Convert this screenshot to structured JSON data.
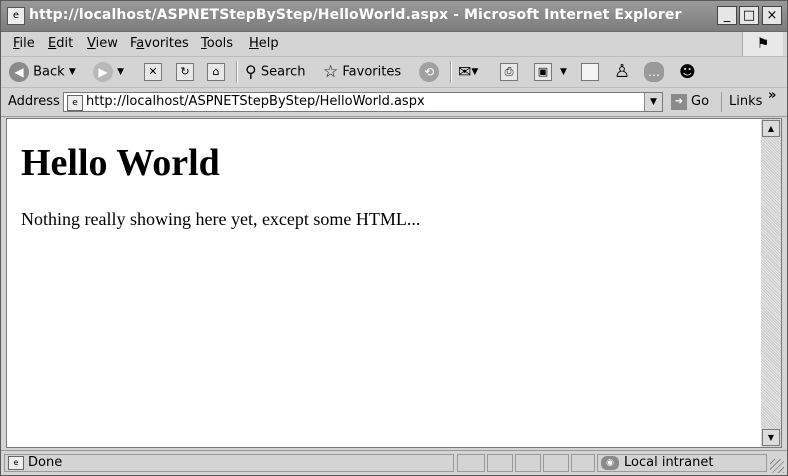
{
  "window": {
    "title": "http://localhost/ASPNETStepByStep/HelloWorld.aspx - Microsoft Internet Explorer",
    "minimize": "_",
    "maximize": "□",
    "close": "×"
  },
  "menu": {
    "items": [
      {
        "key": "F",
        "rest": "ile"
      },
      {
        "key": "E",
        "rest": "dit"
      },
      {
        "key": "V",
        "rest": "iew"
      },
      {
        "key": "a",
        "pre": "F",
        "rest": "vorites"
      },
      {
        "key": "T",
        "rest": "ools"
      },
      {
        "key": "H",
        "rest": "elp"
      }
    ]
  },
  "toolbar": {
    "back_label": "Back",
    "search_label": "Search",
    "favorites_label": "Favorites"
  },
  "address": {
    "label": "Address",
    "url": "http://localhost/ASPNETStepByStep/HelloWorld.aspx",
    "go_label": "Go",
    "links_label": "Links",
    "more": "»"
  },
  "page": {
    "heading": "Hello World",
    "body": "Nothing really showing here yet, except some HTML..."
  },
  "status": {
    "text": "Done",
    "zone": "Local intranet"
  },
  "colors": {
    "titlebar": "#8a8a8a",
    "chrome": "#d4d4d4",
    "content_bg": "#ffffff"
  }
}
